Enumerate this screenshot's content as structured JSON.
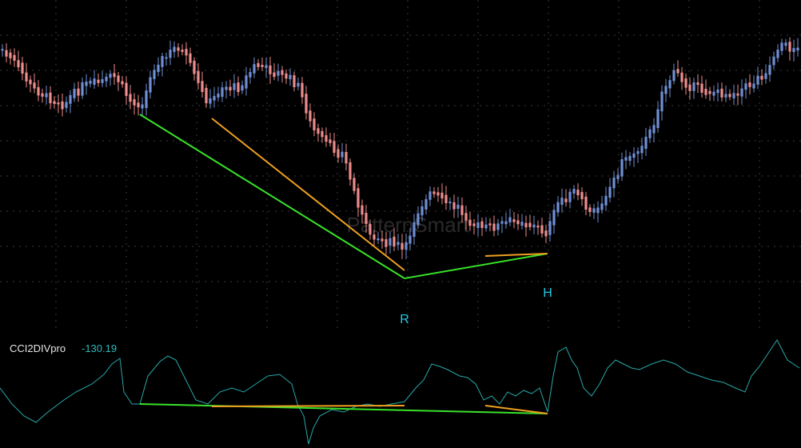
{
  "chart_data": {
    "type": "candlestick",
    "watermark": "PatternSmart",
    "colors": {
      "background": "#000000",
      "grid": "#3a3a3a",
      "bull": "#6f8fd6",
      "bear": "#f08d8d",
      "divergence_main": "#39e12a",
      "divergence_secondary": "#f0a020",
      "oscillator": "#2aa7a7",
      "label": "#21c8e6",
      "indicator_value": "#2fb8b8"
    },
    "price_labels": [
      "R",
      "H"
    ],
    "indicator": {
      "name": "CCI2DIVpro",
      "value": "-130.19"
    },
    "divergence_notes": [
      "green: price lower low vs CCI higher low (start ~bar 44 to R, then R to H)",
      "orange: secondary divergence lines"
    ]
  }
}
